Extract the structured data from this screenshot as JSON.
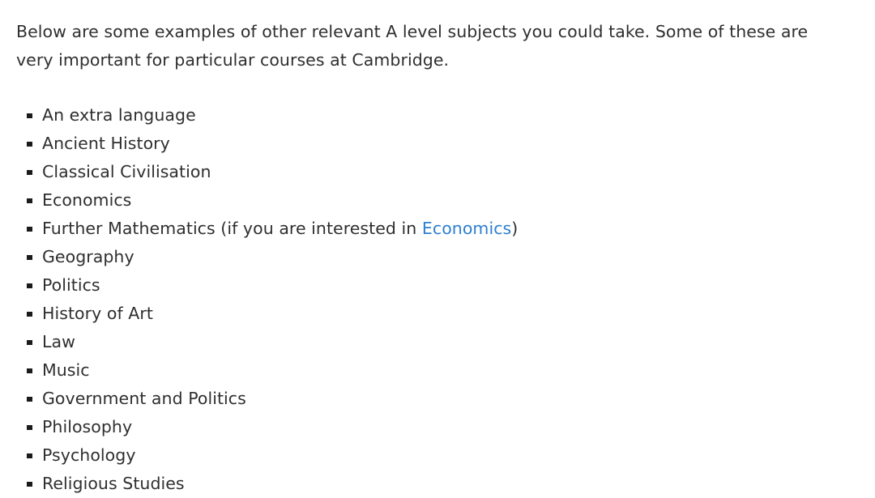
{
  "document": {
    "intro_paragraph": "Below are some examples of other relevant A level subjects you could take. Some of these are very important for particular courses at Cambridge.",
    "list": {
      "bullet_glyph": "square",
      "items": [
        {
          "text": "An extra language"
        },
        {
          "text": "Ancient History"
        },
        {
          "text": "Classical Civilisation"
        },
        {
          "text": "Economics"
        },
        {
          "text": "Further Mathematics (if you are interested in Economics)",
          "prefix": "Further Mathematics (if you are interested in ",
          "link_text": "Economics",
          "suffix": ")"
        },
        {
          "text": "Geography"
        },
        {
          "text": "Politics"
        },
        {
          "text": "History of Art"
        },
        {
          "text": "Law"
        },
        {
          "text": "Music"
        },
        {
          "text": "Government and Politics"
        },
        {
          "text": "Philosophy"
        },
        {
          "text": "Psychology"
        },
        {
          "text": "Religious Studies"
        }
      ]
    }
  },
  "colors": {
    "background": "#ffffff",
    "body_text": "#2f2f2f",
    "link": "#2d7fd0",
    "bullet": "#1b1b1b"
  }
}
